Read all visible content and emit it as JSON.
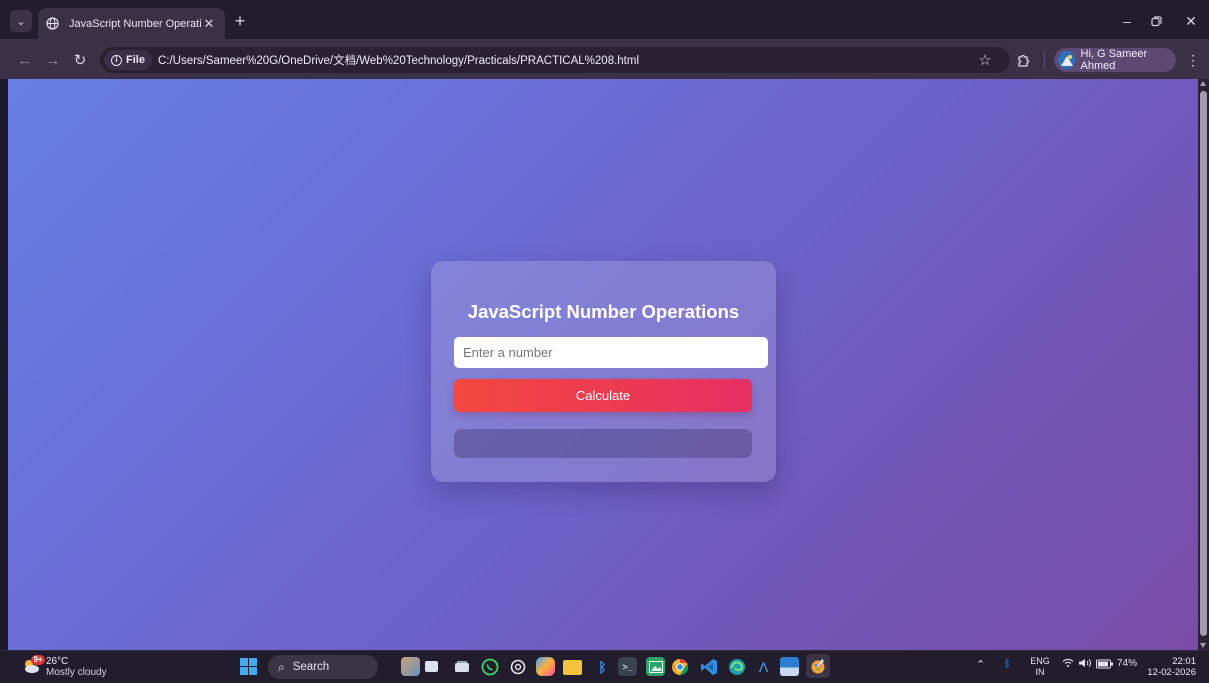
{
  "browser": {
    "tab_title": "JavaScript Number Operations",
    "file_label": "File",
    "url": "C:/Users/Sameer%20G/OneDrive/文档/Web%20Technology/Practicals/PRACTICAL%208.html",
    "profile_label": "Hi, G Sameer Ahmed"
  },
  "page": {
    "heading": "JavaScript Number Operations",
    "input_placeholder": "Enter a number",
    "input_value": "",
    "button_label": "Calculate",
    "result_text": "",
    "background_colors": [
      "#687ee4",
      "#7156b7",
      "#7a4ca7"
    ],
    "button_colors": [
      "#f3483f",
      "#e62f63"
    ]
  },
  "taskbar": {
    "weather_badge": "9+",
    "temperature": "26°C",
    "condition": "Mostly cloudy",
    "search_label": "Search",
    "pinned_icons": [
      "widgets-icon",
      "taskview-icon",
      "whatsapp-icon",
      "chatgpt-icon",
      "copilot-icon",
      "file-explorer-icon",
      "bluetooth-icon",
      "terminal-icon",
      "photos-icon",
      "chrome-icon",
      "vscode-icon",
      "edge-icon",
      "a-icon",
      "word-icon",
      "paint-icon"
    ],
    "language_line1": "ENG",
    "language_line2": "IN",
    "battery": "74%",
    "time": "22:01",
    "date": "12-02-2026"
  }
}
